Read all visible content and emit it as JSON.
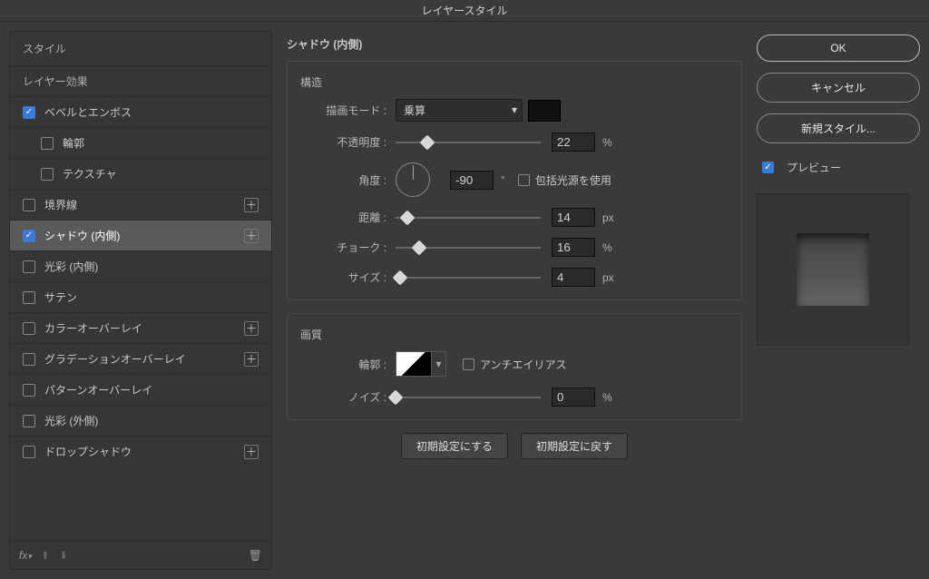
{
  "title": "レイヤースタイル",
  "sidebar": {
    "styles_label": "スタイル",
    "effects_label": "レイヤー効果",
    "items": [
      {
        "label": "ベベルとエンボス",
        "checked": true,
        "addable": false,
        "indent": 0
      },
      {
        "label": "輪郭",
        "checked": false,
        "addable": false,
        "indent": 1
      },
      {
        "label": "テクスチャ",
        "checked": false,
        "addable": false,
        "indent": 1
      },
      {
        "label": "境界線",
        "checked": false,
        "addable": true,
        "indent": 0
      },
      {
        "label": "シャドウ (内側)",
        "checked": true,
        "addable": true,
        "indent": 0,
        "selected": true
      },
      {
        "label": "光彩 (内側)",
        "checked": false,
        "addable": false,
        "indent": 0
      },
      {
        "label": "サテン",
        "checked": false,
        "addable": false,
        "indent": 0
      },
      {
        "label": "カラーオーバーレイ",
        "checked": false,
        "addable": true,
        "indent": 0
      },
      {
        "label": "グラデーションオーバーレイ",
        "checked": false,
        "addable": true,
        "indent": 0
      },
      {
        "label": "パターンオーバーレイ",
        "checked": false,
        "addable": false,
        "indent": 0
      },
      {
        "label": "光彩 (外側)",
        "checked": false,
        "addable": false,
        "indent": 0
      },
      {
        "label": "ドロップシャドウ",
        "checked": false,
        "addable": true,
        "indent": 0
      }
    ],
    "fx_label": "fx"
  },
  "panel": {
    "title": "シャドウ (内側)",
    "structure": {
      "title": "構造",
      "blend_mode_label": "描画モード :",
      "blend_mode_value": "乗算",
      "color": "#151515",
      "opacity_label": "不透明度 :",
      "opacity_value": "22",
      "opacity_unit": "%",
      "angle_label": "角度 :",
      "angle_value": "-90",
      "angle_unit": "°",
      "global_light_label": "包括光源を使用",
      "global_light_checked": false,
      "distance_label": "距離 :",
      "distance_value": "14",
      "distance_unit": "px",
      "choke_label": "チョーク :",
      "choke_value": "16",
      "choke_unit": "%",
      "size_label": "サイズ :",
      "size_value": "4",
      "size_unit": "px"
    },
    "quality": {
      "title": "画質",
      "contour_label": "輪郭 :",
      "antialias_label": "アンチエイリアス",
      "antialias_checked": false,
      "noise_label": "ノイズ :",
      "noise_value": "0",
      "noise_unit": "%"
    },
    "buttons": {
      "make_default": "初期設定にする",
      "reset_default": "初期設定に戻す"
    }
  },
  "right": {
    "ok": "OK",
    "cancel": "キャンセル",
    "new_style": "新規スタイル...",
    "preview_label": "プレビュー",
    "preview_checked": true
  }
}
